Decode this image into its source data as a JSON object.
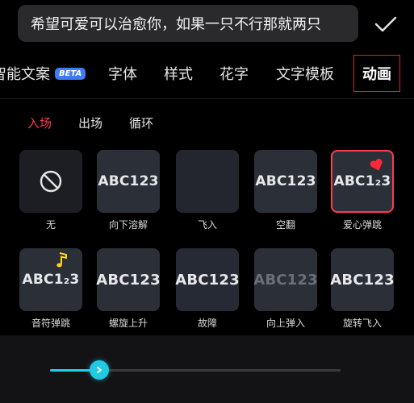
{
  "text_input": {
    "value": "希望可爱可以治愈你，如果一只不行那就两只"
  },
  "tabs": [
    {
      "label": "智能文案",
      "badge": "BETA"
    },
    {
      "label": "字体"
    },
    {
      "label": "样式"
    },
    {
      "label": "花字"
    },
    {
      "label": "文字模板"
    },
    {
      "label": "动画",
      "active": true
    }
  ],
  "subtabs": [
    {
      "label": "入场",
      "active": true
    },
    {
      "label": "出场"
    },
    {
      "label": "循环"
    }
  ],
  "animations": [
    {
      "label": "无",
      "preview": "",
      "icon": "no-symbol-icon"
    },
    {
      "label": "向下溶解",
      "preview": "ABC123"
    },
    {
      "label": "飞入",
      "preview": ""
    },
    {
      "label": "空翻",
      "preview": "ABC123"
    },
    {
      "label": "爱心弹跳",
      "preview": "ABC1₂3",
      "selected": true
    },
    {
      "label": "音符弹跳",
      "preview": "ABC1₂3"
    },
    {
      "label": "螺旋上升",
      "preview": "ABC123"
    },
    {
      "label": "故障",
      "preview": "ABC123"
    },
    {
      "label": "向上弹入",
      "preview": "ABC123"
    },
    {
      "label": "旋转飞入",
      "preview": "ABC123"
    }
  ],
  "slider": {
    "value": 0.17
  },
  "colors": {
    "accent": "#ff3a55",
    "slider": "#19d3ea",
    "beta": "#3c7cf5"
  }
}
